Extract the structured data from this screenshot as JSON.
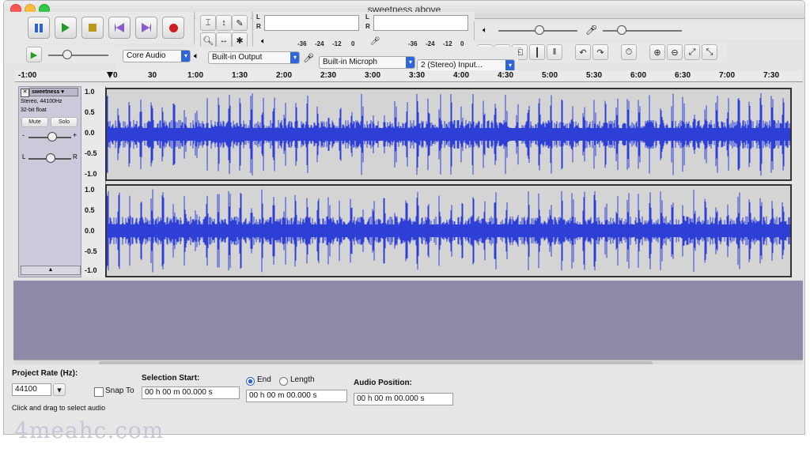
{
  "window": {
    "title": "sweetness above"
  },
  "transport": {
    "buttons": [
      {
        "name": "pause-button",
        "icon": "pause-icon",
        "color": "#2b63c9"
      },
      {
        "name": "play-button",
        "icon": "play-icon",
        "color": "#1f9a2b"
      },
      {
        "name": "stop-button",
        "icon": "stop-icon",
        "color": "#b89a1c"
      },
      {
        "name": "skip-start-button",
        "icon": "skip-start-icon",
        "color": "#8a5bd0"
      },
      {
        "name": "skip-end-button",
        "icon": "skip-end-icon",
        "color": "#8a5bd0"
      },
      {
        "name": "record-button",
        "icon": "record-icon",
        "color": "#cc1f1f"
      }
    ]
  },
  "meters": {
    "output_ticks": [
      "-36",
      "-24",
      "-12",
      "0"
    ],
    "input_ticks": [
      "-36",
      "-24",
      "-12",
      "0"
    ],
    "output_channels": [
      "L",
      "R"
    ],
    "input_channels": [
      "L",
      "R"
    ]
  },
  "devices": {
    "host": "Core Audio",
    "output": "Built-in Output",
    "input": "Built-in Microph",
    "channels": "2 (Stereo) Input..."
  },
  "timeline": {
    "start_label": "-1:00",
    "zero_label": "0",
    "labels": [
      "30",
      "1:00",
      "1:30",
      "2:00",
      "2:30",
      "3:00",
      "3:30",
      "4:00",
      "4:30",
      "5:00",
      "5:30",
      "6:00",
      "6:30",
      "7:00",
      "7:30"
    ]
  },
  "track": {
    "name": "sweetness",
    "rate": "Stereo, 44100Hz",
    "format": "32-bit float",
    "mute_label": "Mute",
    "solo_label": "Solo",
    "gain_minus": "-",
    "gain_plus": "+",
    "pan_left": "L",
    "pan_right": "R",
    "vruler_top": [
      "1.0",
      "0.5",
      "0.0",
      "-0.5",
      "-1.0"
    ],
    "vruler_bottom": [
      "1.0",
      "0.5",
      "0.0",
      "-0.5",
      "-1.0"
    ],
    "wave_color": "#2e3fd6"
  },
  "selection": {
    "project_rate_label": "Project Rate (Hz):",
    "project_rate_value": "44100",
    "snap_to_label": "Snap To",
    "selection_start_label": "Selection Start:",
    "selection_start_value": "00 h 00 m 00.000 s",
    "end_label": "End",
    "length_label": "Length",
    "end_value": "00 h 00 m 00.000 s",
    "audio_position_label": "Audio Position:",
    "audio_position_value": "00 h 00 m 00.000 s"
  },
  "status": {
    "hint": "Click and drag to select audio"
  },
  "watermark": {
    "text": "4meahc.com"
  }
}
